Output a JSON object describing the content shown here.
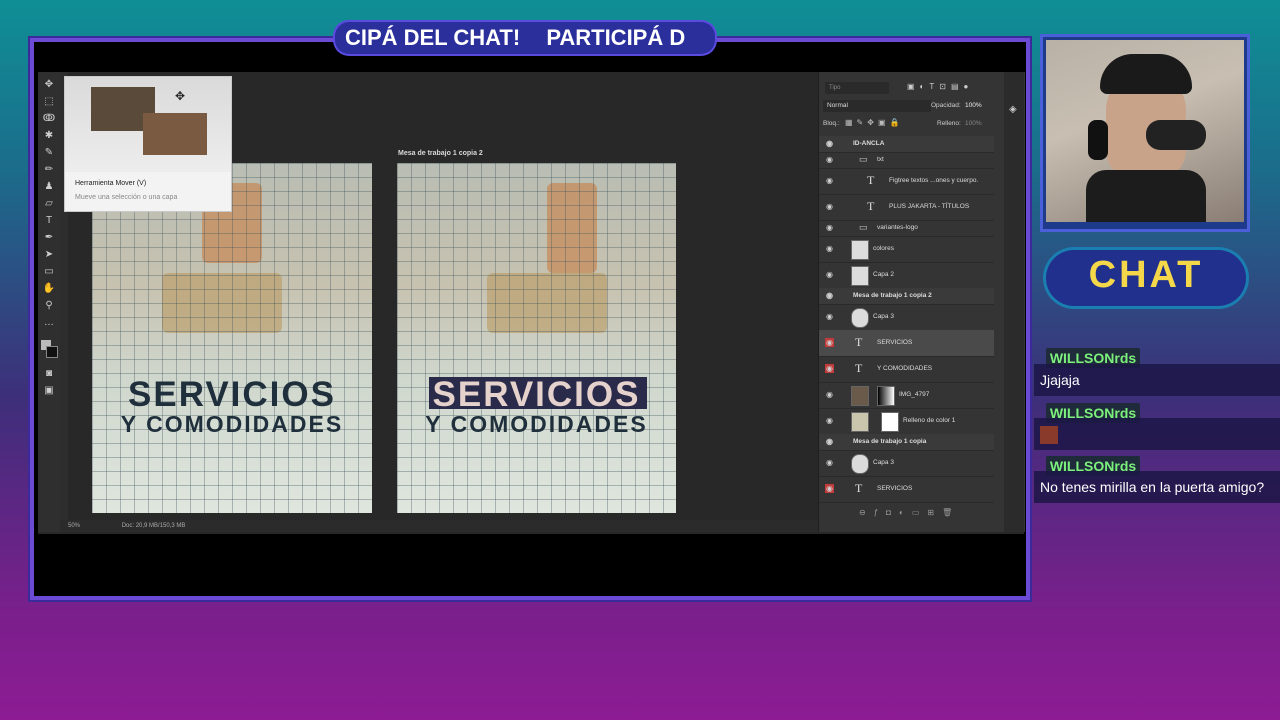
{
  "ticker": {
    "text1": "CIPÁ DEL CHAT!",
    "text2": "PARTICIPÁ D"
  },
  "photoshop": {
    "tooltip": {
      "title": "Herramienta Mover (V)",
      "desc": "Mueve una selección o una capa"
    },
    "artboard_label": "Mesa de trabajo 1 copia 2",
    "artboard_text1": "SERVICIOS",
    "artboard_text2": "Y COMODIDADES",
    "status": {
      "zoom": "50%",
      "doc": "Doc: 20,9 MB/150,3 MB"
    },
    "panel": {
      "search_placeholder": "Tipo",
      "blend_mode": "Normal",
      "opacity_label": "Opacidad:",
      "opacity_value": "100%",
      "lock_label": "Bloq.:",
      "fill_label": "Relleno:",
      "fill_value": "100%",
      "layers": [
        {
          "name": "ID-ANCLA",
          "kind": "group"
        },
        {
          "name": "txt",
          "kind": "folder"
        },
        {
          "name": "Figtree textos ...ones y cuerpo.",
          "kind": "text"
        },
        {
          "name": "PLUS JAKARTA - TÍTULOS",
          "kind": "text"
        },
        {
          "name": "variantes-logo",
          "kind": "folder"
        },
        {
          "name": "colores",
          "kind": "image"
        },
        {
          "name": "Capa 2",
          "kind": "image"
        },
        {
          "name": "Mesa de trabajo 1 copia 2",
          "kind": "group"
        },
        {
          "name": "Capa 3",
          "kind": "image"
        },
        {
          "name": "SERVICIOS",
          "kind": "text"
        },
        {
          "name": "Y COMODIDADES",
          "kind": "text"
        },
        {
          "name": "IMG_4797",
          "kind": "image"
        },
        {
          "name": "Relleno de color 1",
          "kind": "image"
        },
        {
          "name": "Mesa de trabajo 1 copia",
          "kind": "group"
        },
        {
          "name": "Capa 3",
          "kind": "image"
        },
        {
          "name": "SERVICIOS",
          "kind": "text"
        }
      ]
    }
  },
  "chat": {
    "title": "CHAT",
    "messages": [
      {
        "user": "WILLSONrds",
        "text": "Jjajaja"
      },
      {
        "user": "WILLSONrds",
        "text": ""
      },
      {
        "user": "WILLSONrds",
        "text": "No tenes mirilla en la puerta amigo?"
      }
    ]
  },
  "colors": {
    "accent": "#f5d84a",
    "username": "#7cf07c",
    "frame": "#6b4ad6"
  }
}
